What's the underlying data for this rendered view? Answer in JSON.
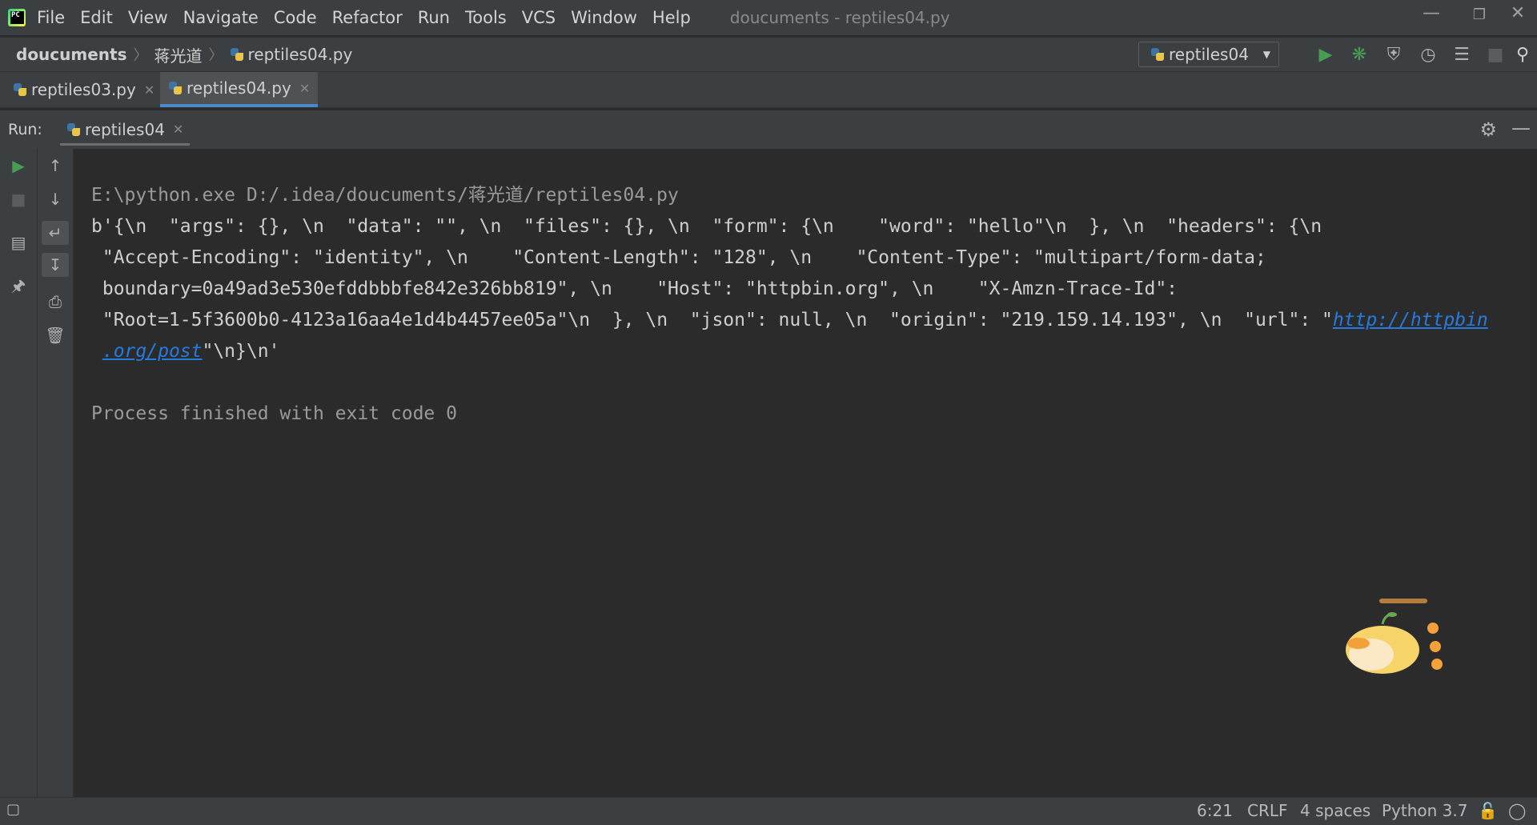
{
  "menubar": {
    "items": [
      "File",
      "Edit",
      "View",
      "Navigate",
      "Code",
      "Refactor",
      "Run",
      "Tools",
      "VCS",
      "Window",
      "Help"
    ],
    "window_title": "doucuments - reptiles04.py"
  },
  "breadcrumb": {
    "project": "doucuments",
    "folder": "蒋光道",
    "file": "reptiles04.py"
  },
  "toolbar": {
    "run_config": "reptiles04",
    "icons": [
      "run-icon",
      "debug-icon",
      "coverage-icon",
      "profile-icon",
      "concurrency-icon",
      "stop-icon",
      "search-icon"
    ]
  },
  "tabs": [
    {
      "label": "reptiles03.py",
      "active": false
    },
    {
      "label": "reptiles04.py",
      "active": true
    }
  ],
  "run_panel": {
    "label": "Run:",
    "tab_label": "reptiles04"
  },
  "console": {
    "command": "E:\\python.exe D:/.idea/doucuments/蒋光道/reptiles04.py",
    "output_lines": [
      "b'{\\n  \"args\": {}, \\n  \"data\": \"\", \\n  \"files\": {}, \\n  \"form\": {\\n    \"word\": \"hello\"\\n  }, \\n  \"headers\": {\\n",
      " \"Accept-Encoding\": \"identity\", \\n    \"Content-Length\": \"128\", \\n    \"Content-Type\": \"multipart/form-data;",
      " boundary=0a49ad3e530efddbbbfe842e326bb819\", \\n    \"Host\": \"httpbin.org\", \\n    \"X-Amzn-Trace-Id\":",
      " \"Root=1-5f3600b0-4123a16aa4e1d4b4457ee05a\"\\n  }, \\n  \"json\": null, \\n  \"origin\": \"219.159.14.193\", \\n  \"url\": \""
    ],
    "link_part1": "http://httpbin",
    "link_part2": ".org/post",
    "tail": "\"\\n}\\n'",
    "exit_message": "Process finished with exit code 0"
  },
  "statusbar": {
    "position": "6:21",
    "line_separator": "CRLF",
    "indent": "4 spaces",
    "interpreter": "Python 3.7"
  },
  "colors": {
    "background": "#2b2b2b",
    "panel": "#3c3f41",
    "accent": "#4a88c7",
    "run_green": "#499c54",
    "link": "#287bde"
  }
}
